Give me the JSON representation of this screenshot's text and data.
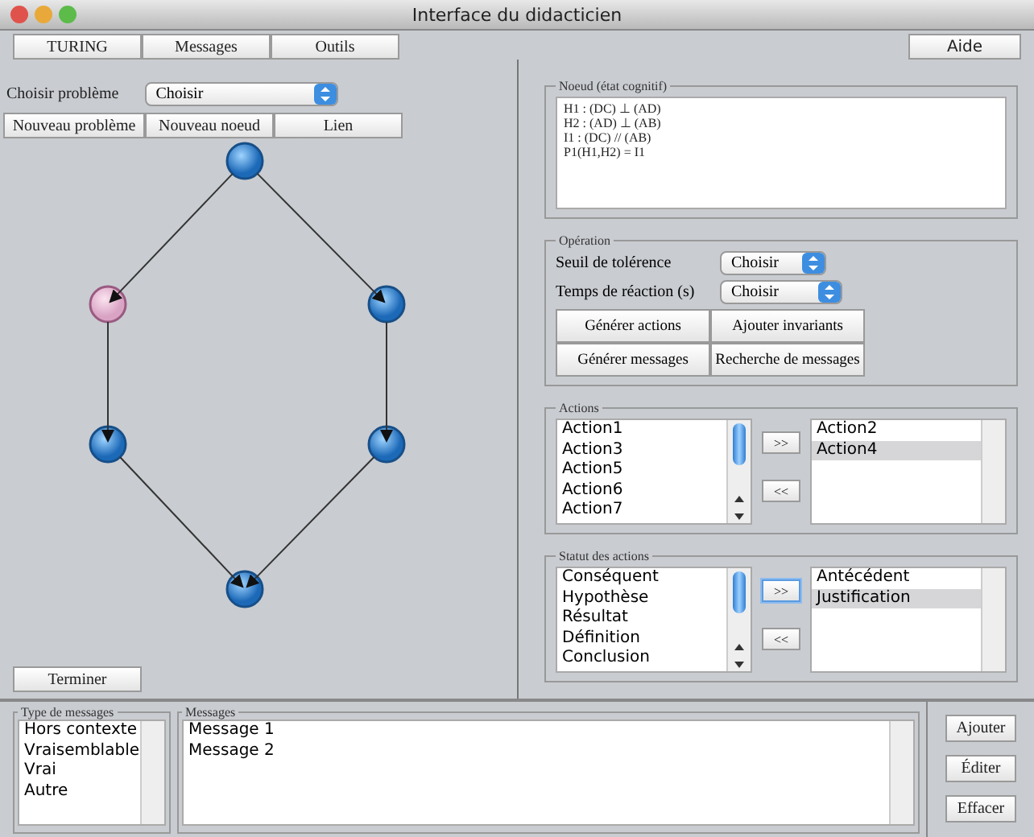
{
  "window": {
    "title": "Interface du didacticien"
  },
  "menu_tabs": [
    "TURING",
    "Messages",
    "Outils"
  ],
  "help_button": "Aide",
  "problem": {
    "label": "Choisir problème",
    "select": "Choisir"
  },
  "graph_buttons": [
    "Nouveau problème",
    "Nouveau noeud",
    "Lien"
  ],
  "graph": {
    "nodes": [
      {
        "selected": false
      },
      {
        "selected": true
      },
      {
        "selected": false
      },
      {
        "selected": false
      },
      {
        "selected": false
      },
      {
        "selected": false
      }
    ]
  },
  "finish_button": "Terminer",
  "node_panel": {
    "legend": "Noeud (état cognitif)",
    "lines": [
      "H1 : (DC) ⊥ (AD)",
      "H2 : (AD) ⊥ (AB)",
      "I1 : (DC) // (AB)",
      "P1(H1,H2) = I1"
    ]
  },
  "operation": {
    "legend": "Opération",
    "fields": [
      {
        "label": "Seuil de tolérence",
        "select": "Choisir"
      },
      {
        "label": "Temps de réaction (s)",
        "select": "Choisir"
      }
    ],
    "buttons": [
      "Générer actions",
      "Ajouter invariants",
      "Générer messages",
      "Recherche de messages"
    ]
  },
  "transfer_panels": [
    {
      "legend": "Actions",
      "left": [
        "Action1",
        "Action3",
        "Action5",
        "Action6",
        "Action7"
      ],
      "add": ">>",
      "remove": "<<",
      "add_focused": false,
      "right": [
        {
          "label": "Action2",
          "selected": false
        },
        {
          "label": "Action4",
          "selected": true
        }
      ]
    },
    {
      "legend": "Statut des actions",
      "left": [
        "Conséquent",
        "Hypothèse",
        "Résultat",
        "Définition",
        "Conclusion"
      ],
      "add": ">>",
      "remove": "<<",
      "add_focused": true,
      "right": [
        {
          "label": "Antécédent",
          "selected": false
        },
        {
          "label": "Justification",
          "selected": true
        }
      ]
    }
  ],
  "message_types": {
    "legend": "Type de messages",
    "items": [
      "Hors contexte",
      "Vraisemblable",
      "Vrai",
      "Autre"
    ]
  },
  "messages": {
    "legend": "Messages",
    "items": [
      "Message 1",
      "Message 2"
    ]
  },
  "message_buttons": [
    "Ajouter",
    "Éditer",
    "Effacer"
  ]
}
